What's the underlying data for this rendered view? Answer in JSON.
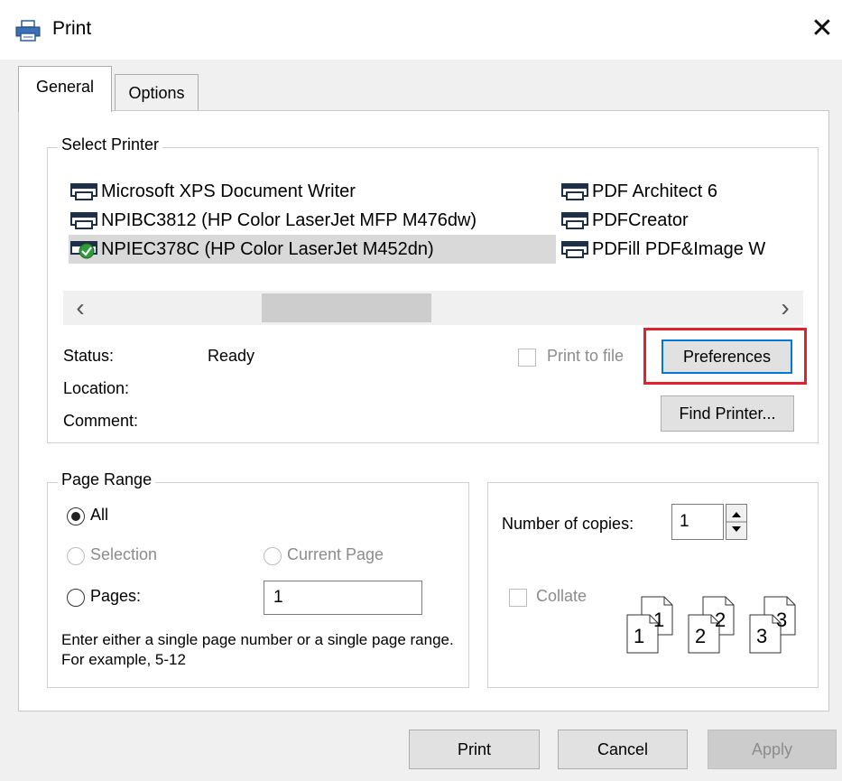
{
  "window": {
    "title": "Print",
    "close_glyph": "✕"
  },
  "tabs": [
    {
      "label": "General",
      "active": true
    },
    {
      "label": "Options",
      "active": false
    }
  ],
  "select_printer": {
    "legend": "Select Printer",
    "printers_col1": [
      {
        "name": "Microsoft XPS Document Writer",
        "selected": false
      },
      {
        "name": "NPIBC3812 (HP Color LaserJet MFP M476dw)",
        "selected": false
      },
      {
        "name": "NPIEC378C (HP Color LaserJet M452dn)",
        "selected": true,
        "default": true
      }
    ],
    "printers_col2": [
      {
        "name": "PDF Architect 6"
      },
      {
        "name": "PDFCreator"
      },
      {
        "name": "PDFill PDF&Image W"
      }
    ],
    "scroll_left_glyph": "‹",
    "scroll_right_glyph": "›",
    "status_label": "Status:",
    "status_value": "Ready",
    "location_label": "Location:",
    "comment_label": "Comment:",
    "print_to_file_label": "Print to file",
    "preferences_label": "Preferences",
    "find_printer_label": "Find Printer..."
  },
  "page_range": {
    "legend": "Page Range",
    "all_label": "All",
    "selection_label": "Selection",
    "current_page_label": "Current Page",
    "pages_label": "Pages:",
    "pages_value": "1",
    "hint": "Enter either a single page number or a single page range.  For example, 5-12"
  },
  "copies": {
    "label": "Number of copies:",
    "value": "1",
    "collate_label": "Collate",
    "collate_pages": [
      {
        "a": "1",
        "b": "1"
      },
      {
        "a": "2",
        "b": "2"
      },
      {
        "a": "3",
        "b": "3"
      }
    ]
  },
  "buttons": {
    "print": "Print",
    "cancel": "Cancel",
    "apply": "Apply"
  },
  "colors": {
    "highlight": "#e3202d",
    "focus_border": "#0078d7",
    "button_bg": "#e1e1e1",
    "disabled_text": "#8c8c8c"
  }
}
